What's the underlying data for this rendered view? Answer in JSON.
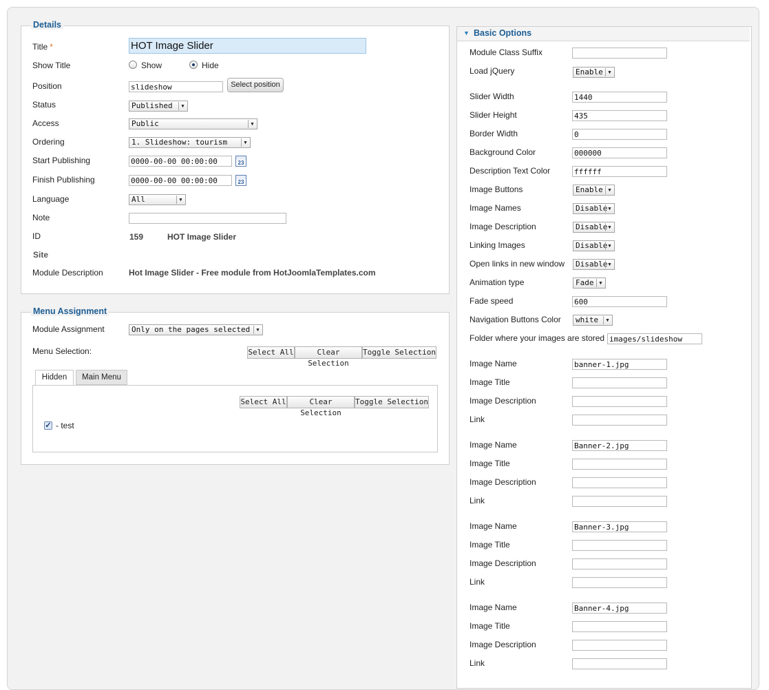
{
  "details": {
    "legend": "Details",
    "title_label": "Title",
    "title_required": "*",
    "title_value": "HOT Image Slider",
    "show_title_label": "Show Title",
    "show_label": "Show",
    "hide_label": "Hide",
    "show_title_selected": "Hide",
    "position_label": "Position",
    "position_value": "slideshow",
    "select_position_label": "Select position",
    "status_label": "Status",
    "status_value": "Published",
    "access_label": "Access",
    "access_value": "Public",
    "ordering_label": "Ordering",
    "ordering_value": "1. Slideshow: tourism",
    "start_label": "Start Publishing",
    "start_value": "0000-00-00 00:00:00",
    "finish_label": "Finish Publishing",
    "finish_value": "0000-00-00 00:00:00",
    "calendar_text": "23",
    "language_label": "Language",
    "language_value": "All",
    "note_label": "Note",
    "note_value": "",
    "id_label": "ID",
    "id_value": "159",
    "id_name": "HOT Image Slider",
    "site_label": "Site",
    "module_desc_label": "Module Description",
    "module_desc_value": "Hot Image Slider - Free module from HotJoomlaTemplates.com"
  },
  "menu_assignment": {
    "legend": "Menu Assignment",
    "module_assignment_label": "Module Assignment",
    "module_assignment_value": "Only on the pages selected",
    "menu_selection_label": "Menu Selection:",
    "select_all": "Select All",
    "clear_selection": "Clear Selection",
    "toggle_selection": "Toggle Selection",
    "tabs": [
      "Hidden",
      "Main Menu"
    ],
    "active_tab": "Hidden",
    "items": [
      {
        "label": "- test",
        "checked": true
      }
    ]
  },
  "basic_options": {
    "header": "Basic Options",
    "module_class_suffix_label": "Module Class Suffix",
    "module_class_suffix_value": "",
    "load_jquery_label": "Load jQuery",
    "load_jquery_value": "Enable",
    "slider_width_label": "Slider Width",
    "slider_width_value": "1440",
    "slider_height_label": "Slider Height",
    "slider_height_value": "435",
    "border_width_label": "Border Width",
    "border_width_value": "0",
    "bg_color_label": "Background Color",
    "bg_color_value": "000000",
    "desc_text_color_label": "Description Text Color",
    "desc_text_color_value": "ffffff",
    "image_buttons_label": "Image Buttons",
    "image_buttons_value": "Enable",
    "image_names_label": "Image Names",
    "image_names_value": "Disable",
    "image_description_label": "Image Description",
    "image_description_value": "Disable",
    "linking_images_label": "Linking Images",
    "linking_images_value": "Disable",
    "open_links_label": "Open links in new window",
    "open_links_value": "Disable",
    "animation_type_label": "Animation type",
    "animation_type_value": "Fade",
    "fade_speed_label": "Fade speed",
    "fade_speed_value": "600",
    "nav_color_label": "Navigation Buttons Color",
    "nav_color_value": "white",
    "folder_label": "Folder where your images are stored",
    "folder_value": "images/slideshow",
    "image_name_label": "Image Name",
    "image_title_label": "Image Title",
    "image_desc_label": "Image Description",
    "link_label": "Link",
    "images": [
      {
        "name": "banner-1.jpg",
        "title": "",
        "description": "",
        "link": ""
      },
      {
        "name": "Banner-2.jpg",
        "title": "",
        "description": "",
        "link": ""
      },
      {
        "name": "Banner-3.jpg",
        "title": "",
        "description": "",
        "link": ""
      },
      {
        "name": "Banner-4.jpg",
        "title": "",
        "description": "",
        "link": ""
      }
    ]
  },
  "colors": {
    "accent": "#1d5e94",
    "required": "#e0722c",
    "page_bg": "#f2f2f2"
  },
  "icons": {
    "calendar": "calendar-icon",
    "collapse": "triangle-down-icon",
    "dropdown": "chevron-down-icon"
  }
}
